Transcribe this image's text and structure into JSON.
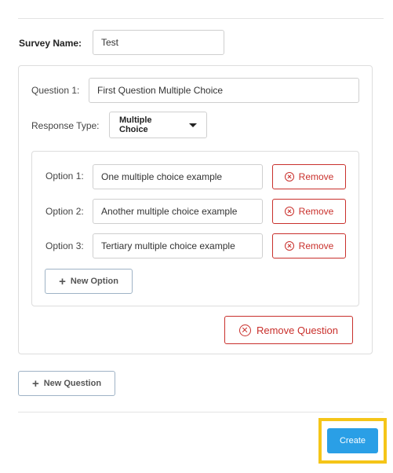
{
  "colors": {
    "accent": "#2a9fe6",
    "danger": "#c9302c",
    "highlight": "#f5c518"
  },
  "survey": {
    "name_label": "Survey Name:",
    "name_value": "Test"
  },
  "question": {
    "label": "Question 1:",
    "value": "First Question Multiple Choice",
    "response_type_label": "Response Type:",
    "response_type_value": "Multiple Choice",
    "options": [
      {
        "label": "Option 1:",
        "value": "One multiple choice example",
        "remove_label": "Remove"
      },
      {
        "label": "Option 2:",
        "value": "Another multiple choice example",
        "remove_label": "Remove"
      },
      {
        "label": "Option 3:",
        "value": "Tertiary multiple choice example",
        "remove_label": "Remove"
      }
    ],
    "new_option_label": "New Option",
    "remove_question_label": "Remove Question"
  },
  "actions": {
    "new_question_label": "New Question",
    "create_label": "Create"
  }
}
